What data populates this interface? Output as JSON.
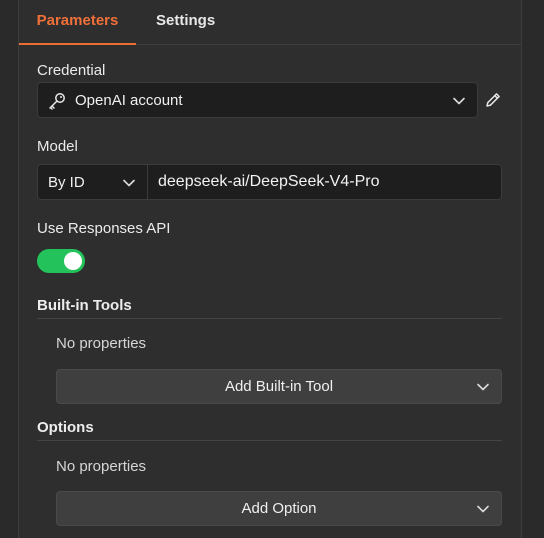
{
  "tabs": [
    {
      "label": "Parameters",
      "active": true
    },
    {
      "label": "Settings",
      "active": false
    }
  ],
  "credential": {
    "label": "Credential",
    "value": "OpenAI account",
    "icon": "key-icon",
    "edit_icon": "pencil-icon"
  },
  "model": {
    "label": "Model",
    "mode": "By ID",
    "value": "deepseek-ai/DeepSeek-V4-Pro"
  },
  "responses_api": {
    "label": "Use Responses API",
    "enabled": true
  },
  "builtin_tools": {
    "heading": "Built-in Tools",
    "empty_text": "No properties",
    "add_label": "Add Built-in Tool"
  },
  "options": {
    "heading": "Options",
    "empty_text": "No properties",
    "add_label": "Add Option"
  },
  "colors": {
    "accent": "#ea6d33",
    "toggle_on": "#24c25a",
    "background": "#2e2e2e"
  }
}
